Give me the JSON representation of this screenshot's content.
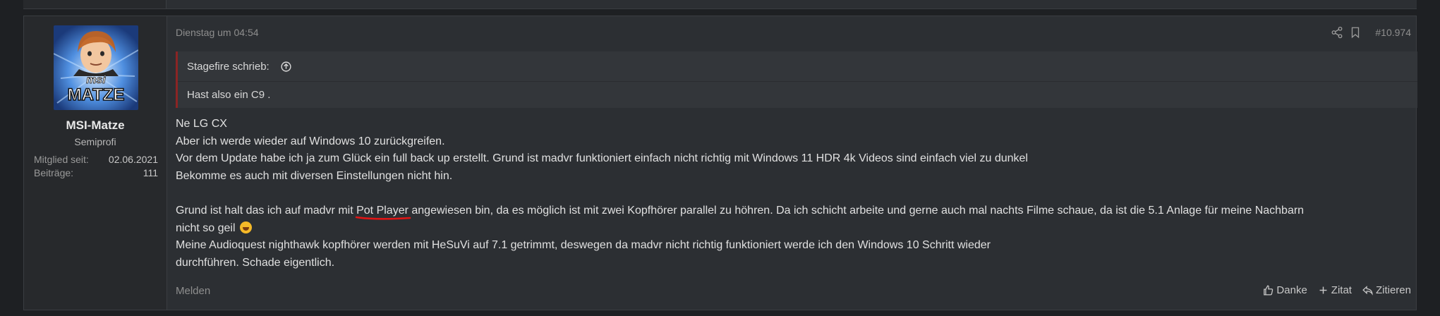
{
  "user": {
    "avatar_text_small": "msi",
    "avatar_text_big": "MATZE",
    "name": "MSI-Matze",
    "title": "Semiprofi",
    "stats": [
      {
        "label": "Mitglied seit:",
        "value": "02.06.2021"
      },
      {
        "label": "Beiträge:",
        "value": "111"
      }
    ]
  },
  "post": {
    "date": "Dienstag um 04:54",
    "number": "#10.974",
    "quote": {
      "author_line": "Stagefire schrieb:",
      "text": "Hast also ein C9 ."
    },
    "message": {
      "line1": "Ne LG CX",
      "line2": "Aber ich werde wieder auf Windows 10 zurückgreifen.",
      "line3": "Vor dem Update habe ich ja zum Glück ein full back up erstellt. Grund ist madvr funktioniert einfach nicht richtig mit Windows 11 HDR 4k Videos sind einfach viel zu dunkel",
      "line4": "Bekomme es auch mit diversen Einstellungen nicht hin.",
      "line5_pre": "Grund ist halt das ich auf madvr mit ",
      "line5_mark": "Pot Player",
      "line5_post": " angewiesen bin, da es möglich ist mit zwei Kopfhörer parallel zu höhren. Da ich schicht arbeite und gerne auch mal nachts Filme schaue, da ist die 5.1 Anlage für meine Nachbarn",
      "line6": "nicht so geil ",
      "line7": "Meine Audioquest nighthawk kopfhörer werden mit HeSuVi auf 7.1 getrimmt, deswegen da madvr nicht richtig funktioniert werde ich den Windows 10 Schritt wieder",
      "line8": "durchführen. Schade eigentlich."
    },
    "report_label": "Melden",
    "actions": {
      "like": "Danke",
      "quote_add": "Zitat",
      "reply": "Zitieren"
    }
  },
  "colors": {
    "quote_border": "#8b2424",
    "annotation_red": "#e01515",
    "background": "#1e2023",
    "panel": "#2c2f33"
  },
  "icons": [
    "share-icon",
    "bookmark-icon",
    "arrow-up-circle-icon",
    "thumbs-up-icon",
    "plus-icon",
    "reply-icon",
    "rofl-emoji-icon"
  ]
}
